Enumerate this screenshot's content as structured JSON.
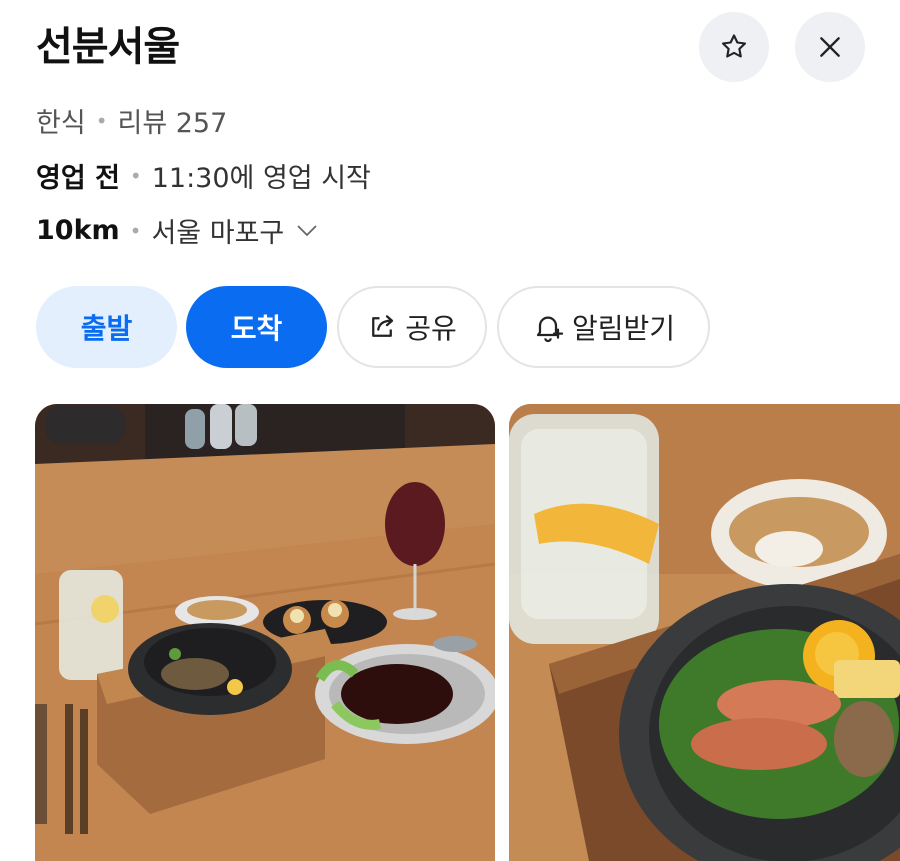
{
  "place": {
    "name": "선분서울",
    "category": "한식",
    "reviews": "리뷰 257",
    "status": "영업 전",
    "status_detail": "11:30에 영업 시작",
    "distance": "10km",
    "location": "서울 마포구"
  },
  "actions": {
    "depart_label": "출발",
    "arrive_label": "도착",
    "share_label": "공유",
    "alarm_label": "알림받기"
  },
  "icons": {
    "favorite": "star-outline-icon",
    "close": "close-icon",
    "expand": "chevron-down-icon",
    "share": "share-icon",
    "alarm": "bell-plus-icon"
  },
  "colors": {
    "accent": "#0a6cf0",
    "accent_light": "#e3effc"
  }
}
